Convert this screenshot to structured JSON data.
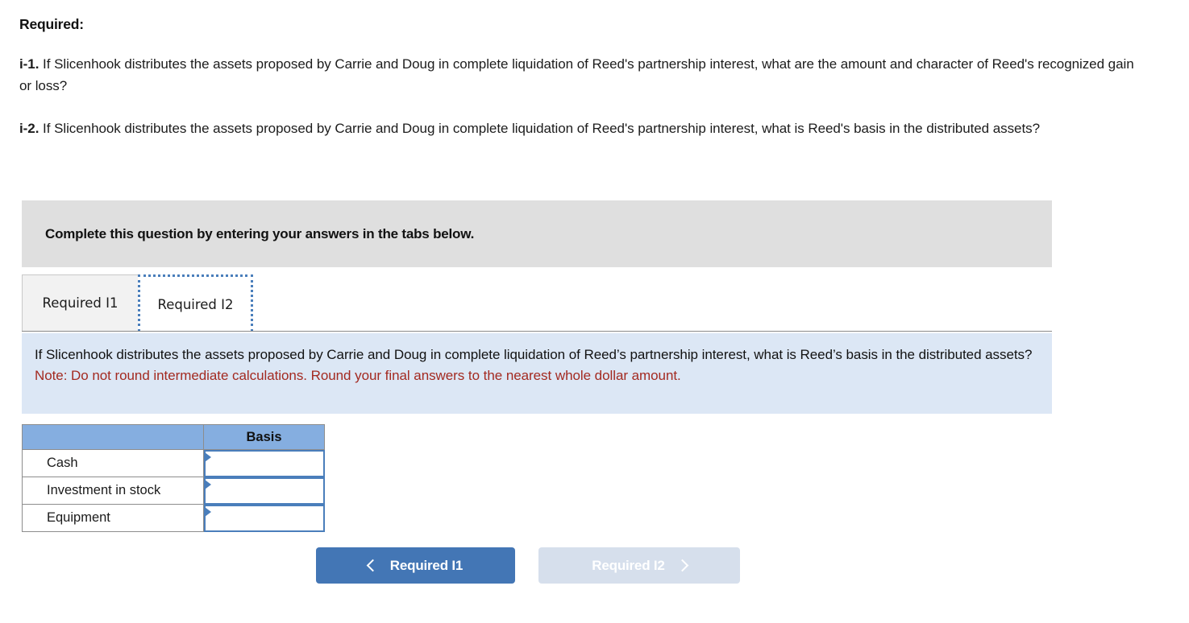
{
  "intro": {
    "heading": "Required:",
    "items": [
      {
        "label": "i-1.",
        "text": " If Slicenhook distributes the assets proposed by Carrie and Doug in complete liquidation of Reed's partnership interest, what are the amount and character of Reed's recognized gain or loss?"
      },
      {
        "label": "i-2.",
        "text": " If Slicenhook distributes the assets proposed by Carrie and Doug in complete liquidation of Reed's partnership interest, what is Reed's basis in the distributed assets?"
      }
    ]
  },
  "banner": {
    "text": "Complete this question by entering your answers in the tabs below."
  },
  "tabs": [
    {
      "label": "Required I1",
      "selected": false
    },
    {
      "label": "Required I2",
      "selected": true
    }
  ],
  "question_panel": {
    "question": "If Slicenhook distributes the assets proposed by Carrie and Doug in complete liquidation of Reed’s partnership interest, what is Reed’s basis in the distributed assets?",
    "note": "Note: Do not round intermediate calculations. Round your final answers to the nearest whole dollar amount."
  },
  "answer_table": {
    "headers": [
      "",
      "Basis"
    ],
    "rows": [
      {
        "label": "Cash",
        "value": "",
        "placeholder": ""
      },
      {
        "label": "Investment in stock",
        "value": "",
        "placeholder": ""
      },
      {
        "label": "Equipment",
        "value": "",
        "placeholder": ""
      }
    ]
  },
  "nav": {
    "prev_label": "Required I1",
    "next_label": "Required I2",
    "prev_icon": "chevron-left-icon",
    "next_icon": "chevron-right-icon"
  },
  "colors": {
    "banner_grey": "#dfdfdf",
    "panel_blue": "#dce7f5",
    "note_red": "#a32a21",
    "table_header_blue": "#85aee0",
    "input_border_blue": "#4a7ebb",
    "button_active_blue": "#4376b5",
    "button_disabled_blue": "#d6dfec"
  }
}
